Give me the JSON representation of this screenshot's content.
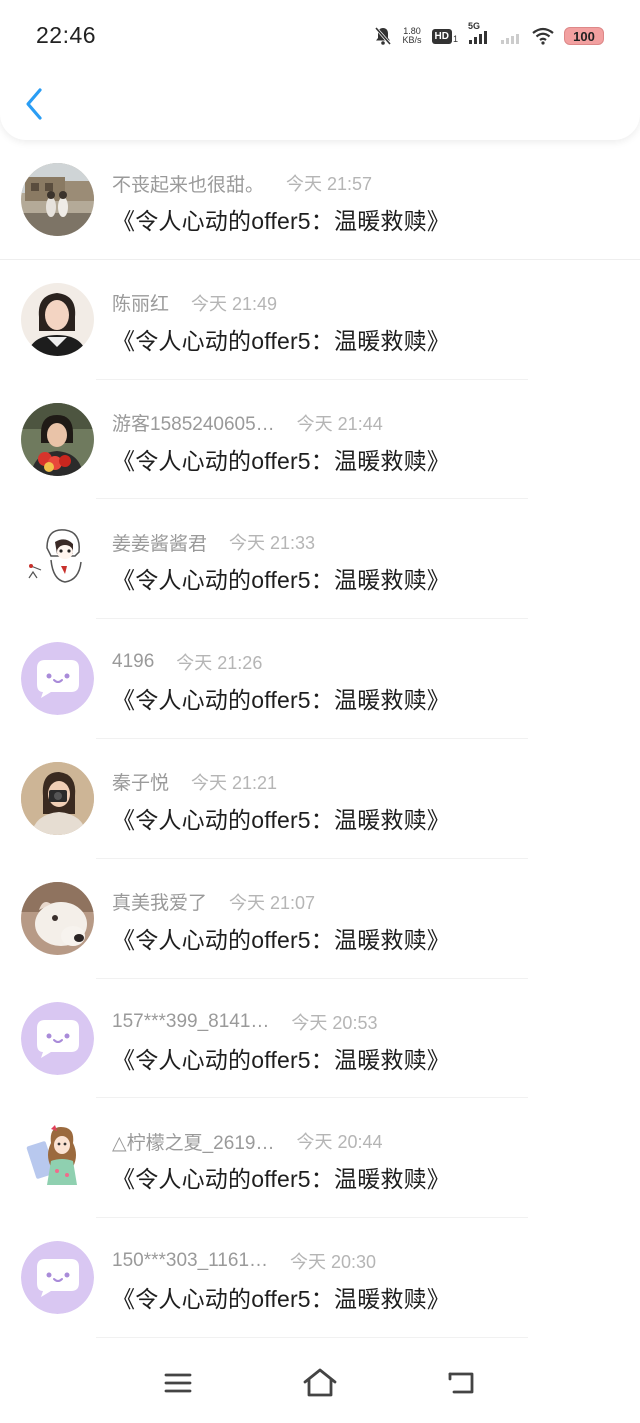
{
  "status_bar": {
    "time": "22:46",
    "speed_value": "1.80",
    "speed_unit": "KB/s",
    "hd_label": "HD",
    "hd_sub": "1",
    "network": "5G",
    "battery": "100"
  },
  "header": {
    "back_icon": "chevron-left-icon",
    "accent_color": "#2a9df4"
  },
  "items": [
    {
      "name": "不丧起来也很甜。",
      "time": "今天 21:57",
      "title": "《令人心动的offer5：温暖救赎》",
      "avatar": "photo-building"
    },
    {
      "name": "陈丽红",
      "time": "今天 21:49",
      "title": "《令人心动的offer5：温暖救赎》",
      "avatar": "photo-woman"
    },
    {
      "name": "游客1585240605…",
      "time": "今天 21:44",
      "title": "《令人心动的offer5：温暖救赎》",
      "avatar": "photo-flowers"
    },
    {
      "name": "姜姜酱酱君",
      "time": "今天 21:33",
      "title": "《令人心动的offer5：温暖救赎》",
      "avatar": "drawing-cartoon"
    },
    {
      "name": "4196",
      "time": "今天 21:26",
      "title": "《令人心动的offer5：温暖救赎》",
      "avatar": "default-chat"
    },
    {
      "name": "秦子悦",
      "time": "今天 21:21",
      "title": "《令人心动的offer5：温暖救赎》",
      "avatar": "photo-camera-girl"
    },
    {
      "name": "真美我爱了",
      "time": "今天 21:07",
      "title": "《令人心动的offer5：温暖救赎》",
      "avatar": "photo-dog"
    },
    {
      "name": "157***399_8141…",
      "time": "今天 20:53",
      "title": "《令人心动的offer5：温暖救赎》",
      "avatar": "default-chat"
    },
    {
      "name": "△柠檬之夏_2619…",
      "time": "今天 20:44",
      "title": "《令人心动的offer5：温暖救赎》",
      "avatar": "drawing-anime"
    },
    {
      "name": "150***303_1161…",
      "time": "今天 20:30",
      "title": "《令人心动的offer5：温暖救赎》",
      "avatar": "default-chat"
    }
  ],
  "nav": {
    "menu_icon": "menu-icon",
    "home_icon": "home-icon",
    "back_icon": "back-icon"
  }
}
